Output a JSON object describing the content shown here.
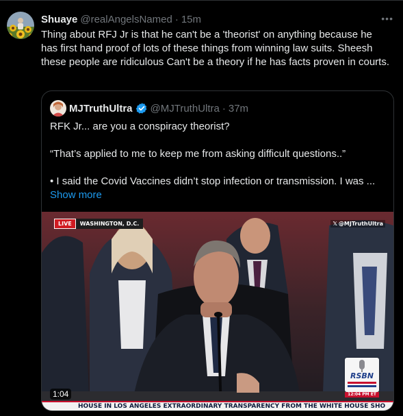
{
  "tweet": {
    "author_name": "Shuaye",
    "author_handle": "@realAngelsNamed",
    "separator": "·",
    "time": "15m",
    "more_icon": "more-horizontal-icon",
    "text": "Thing about RFJ Jr is that he can't be a 'theorist' on anything because he has first hand proof of lots of these things from winning law suits. Sheesh these people are ridiculous Can't be a theory if he has facts proven in courts."
  },
  "quote": {
    "author_name": "MJTruthUltra",
    "author_handle": "@MJTruthUltra",
    "separator": "·",
    "time": "37m",
    "verified_icon": "verified-badge-icon",
    "paragraphs": [
      "RFK Jr... are you a conspiracy theorist?",
      "“That’s applied to me to keep me from asking difficult questions..”",
      "• I said the Covid Vaccines didn’t stop infection or transmission. I was ..."
    ],
    "show_more": "Show more",
    "video": {
      "live_label": "LIVE",
      "location": "WASHINGTON, D.C.",
      "watermark": "@MJTruthUltra",
      "logo_text": "RSBN",
      "logo_time": "12:04 PM ET",
      "ticker": "HOUSE IN LOS ANGELES   EXTRAORDINARY TRANSPARENCY FROM THE WHITE HOUSE SHO",
      "duration": "1:04"
    }
  },
  "colors": {
    "background": "#000000",
    "text_primary": "#e7e9ea",
    "text_secondary": "#71767b",
    "link": "#1d9bf0",
    "border": "#2f3336",
    "live_red": "#d01c22"
  }
}
